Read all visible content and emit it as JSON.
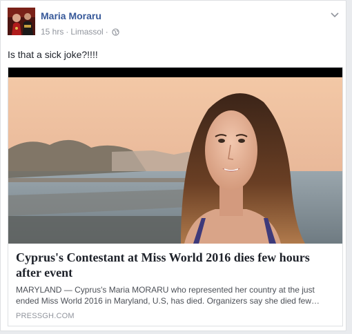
{
  "post": {
    "author": "Maria Moraru",
    "time": "15 hrs",
    "separator": "·",
    "location": "Limassol",
    "text": "Is that a sick joke?!!!!",
    "privacy_icon": "globe-icon",
    "menu_icon": "chevron-down-icon"
  },
  "link_preview": {
    "title": "Cyprus's Contestant at Miss World 2016 dies few hours after event",
    "description": "MARYLAND — Cyprus's Maria MORARU who represented her country at the just ended Miss World 2016 in Maryland, U.S, has died. Organizers say she died few…",
    "domain": "PRESSGH.COM"
  },
  "colors": {
    "name_link": "#365899",
    "meta_gray": "#90949c",
    "text": "#1d2129",
    "border": "#dddfe2"
  }
}
